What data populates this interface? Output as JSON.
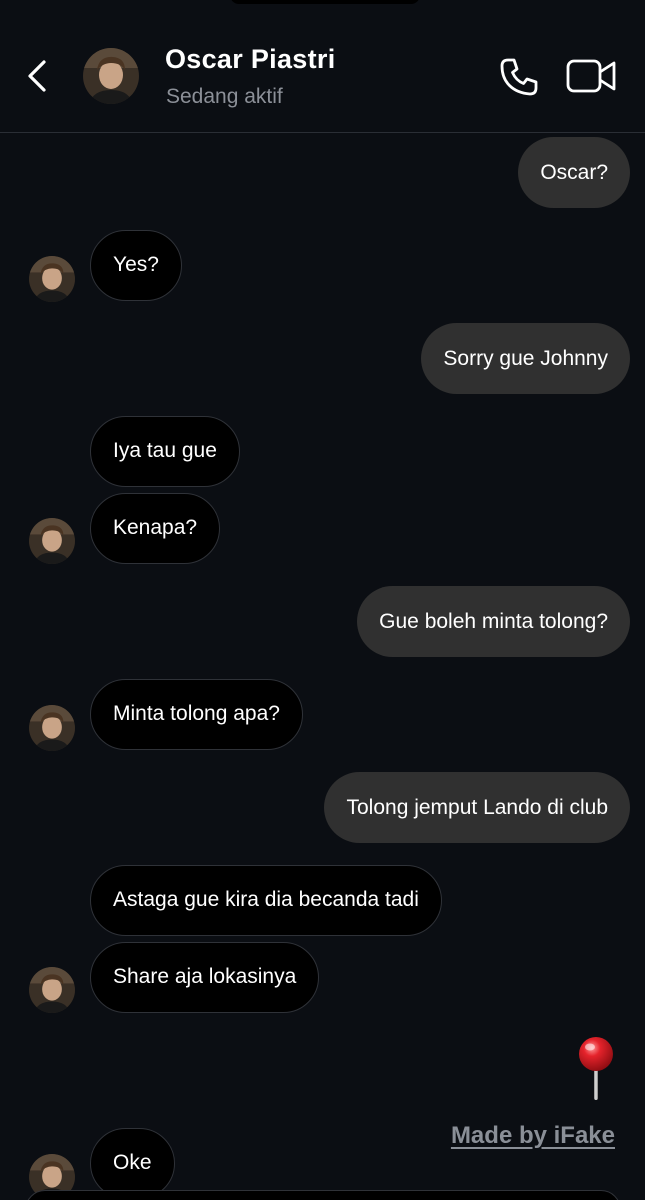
{
  "header": {
    "name": "Oscar Piastri",
    "status": "Sedang aktif",
    "back_icon": "chevron-left-icon",
    "call_icon": "phone-icon",
    "video_icon": "video-camera-icon"
  },
  "messages": [
    {
      "side": "out",
      "text": "Oscar?"
    },
    {
      "side": "in",
      "text": "Yes?"
    },
    {
      "side": "out",
      "text": "Sorry gue Johnny"
    },
    {
      "side": "in",
      "text": "Iya tau gue"
    },
    {
      "side": "in",
      "text": "Kenapa?"
    },
    {
      "side": "out",
      "text": "Gue boleh minta tolong?"
    },
    {
      "side": "in",
      "text": "Minta tolong apa?"
    },
    {
      "side": "out",
      "text": "Tolong jemput Lando di club"
    },
    {
      "side": "in",
      "text": "Astaga gue kira dia becanda tadi"
    },
    {
      "side": "in",
      "text": "Share aja lokasinya"
    },
    {
      "side": "out",
      "text": "📍",
      "type": "emoji"
    },
    {
      "side": "in",
      "text": "Oke"
    }
  ],
  "watermark": "Made by iFake",
  "colors": {
    "background": "#0b0e13",
    "outgoing_bubble": "#303030",
    "incoming_bubble": "#000000",
    "status_text": "#8c9098"
  }
}
